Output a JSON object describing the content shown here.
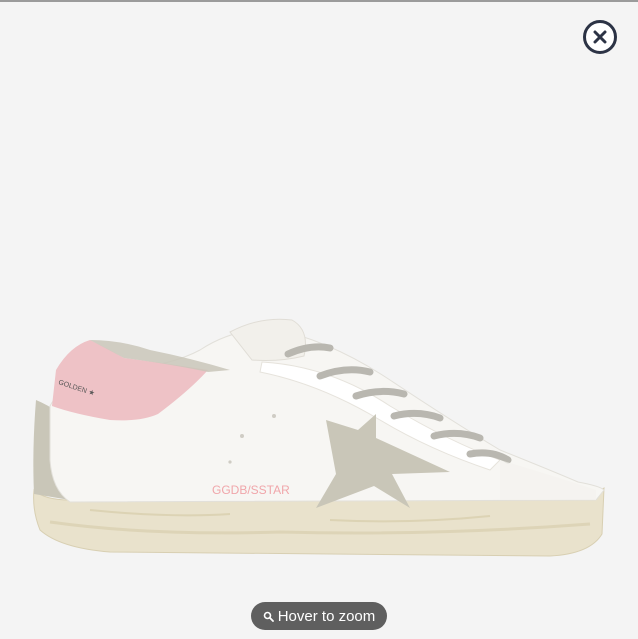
{
  "viewer": {
    "close_label": "Close",
    "product_image": {
      "subject": "white sneaker with pink heel tab and grey suede star",
      "side_print": "GGDB/SSTAR"
    },
    "zoom_hint": {
      "label": "Hover to zoom",
      "icon": "magnifier-icon"
    }
  },
  "colors": {
    "background": "#f4f4f4",
    "close_ring": "#2c3345",
    "pill_bg": "#5f5f5f",
    "sneaker_upper": "#f7f6f3",
    "heel_pink": "#eec2c6",
    "suede_grey": "#c9c6b8",
    "sole": "#e9e2cc",
    "print_pink": "#f0a6aa"
  }
}
